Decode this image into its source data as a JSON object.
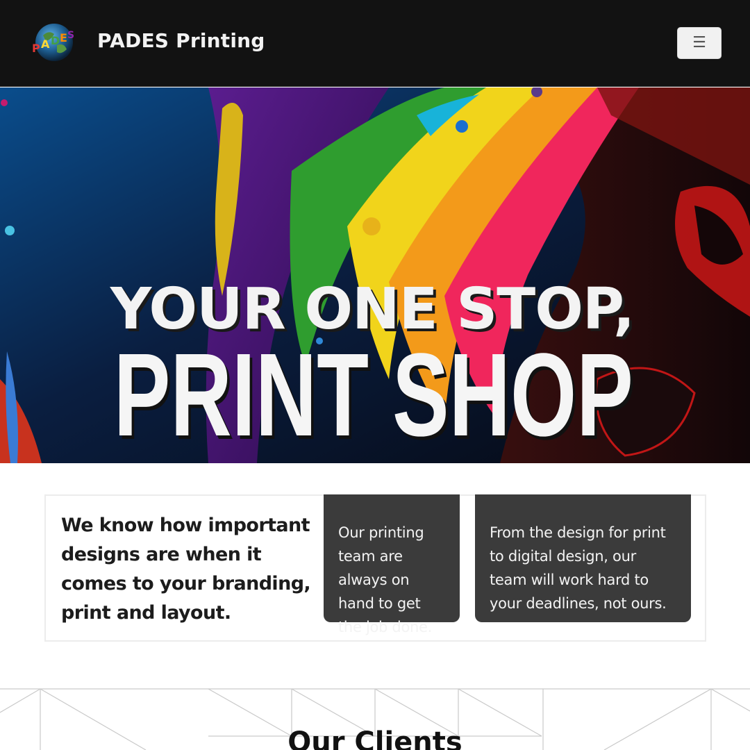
{
  "brand": {
    "name": "PADES Printing",
    "logo_text": "PADES",
    "logo_icon": "globe-logo-icon"
  },
  "navbar": {
    "toggler_icon": "hamburger-menu-icon",
    "toggler_glyph": "☰"
  },
  "hero": {
    "line1": "YOUR ONE STOP,",
    "line2": "PRINT SHOP"
  },
  "features": {
    "intro": "We know how important designs are when it comes to your branding, print and layout.",
    "cards": [
      {
        "text": "Our printing team are always on hand to get the job done."
      },
      {
        "text": "From the design for print to digital design, our team will work hard to your deadlines, not ours."
      }
    ]
  },
  "clients": {
    "title": "Our Clients"
  },
  "colors": {
    "navbar_bg": "#121212",
    "card_bg": "#3b3b3b",
    "text_dark": "#1c1c1c"
  }
}
